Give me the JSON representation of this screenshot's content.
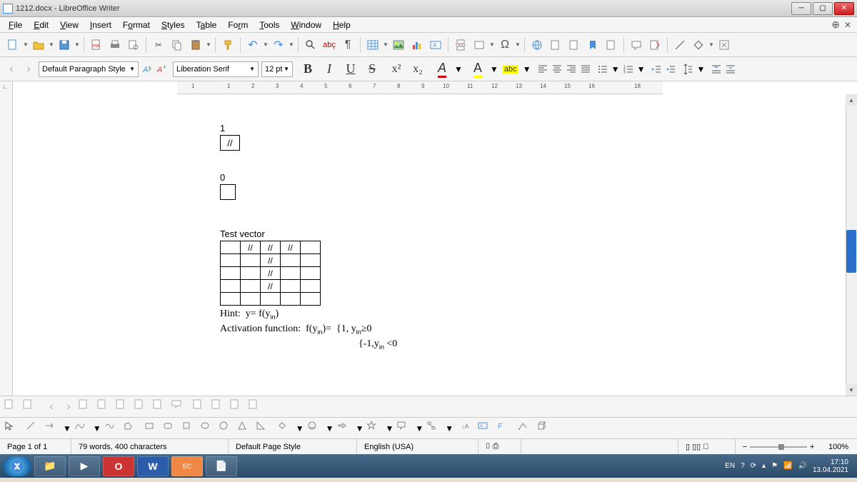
{
  "title": "1212.docx - LibreOffice Writer",
  "menu": {
    "file": "File",
    "edit": "Edit",
    "view": "View",
    "insert": "Insert",
    "format": "Format",
    "styles": "Styles",
    "table": "Table",
    "form": "Form",
    "tools": "Tools",
    "window": "Window",
    "help": "Help"
  },
  "toolbar2": {
    "para_style": "Default Paragraph Style",
    "font_name": "Liberation Serif",
    "font_size": "12 pt",
    "bold": "B",
    "italic": "I",
    "underline": "U",
    "strike": "S",
    "sup": "x²",
    "sub": "x₂",
    "fontcolor": "A",
    "highlight": "A",
    "abc": "abc"
  },
  "document": {
    "one_label": "1",
    "one_cell": "//",
    "zero_label": "0",
    "vector_label": "Test vector",
    "cells": {
      "r0c1": "//",
      "r0c2": "//",
      "r0c3": "//",
      "r1c2": "//",
      "r2c2": "//",
      "r3c2": "//"
    },
    "hint1": "Hint:  y= f(yin)",
    "hint2a": "Activation function:  f(yin)=  {1, yin≥0",
    "hint2b": "{-1,yin <0"
  },
  "status": {
    "page": "Page 1 of 1",
    "words": "79 words, 400 characters",
    "page_style": "Default Page Style",
    "lang": "English (USA)",
    "zoom": "100%"
  },
  "tray": {
    "lang": "EN",
    "time": "17:10",
    "date": "13.04.2021"
  }
}
